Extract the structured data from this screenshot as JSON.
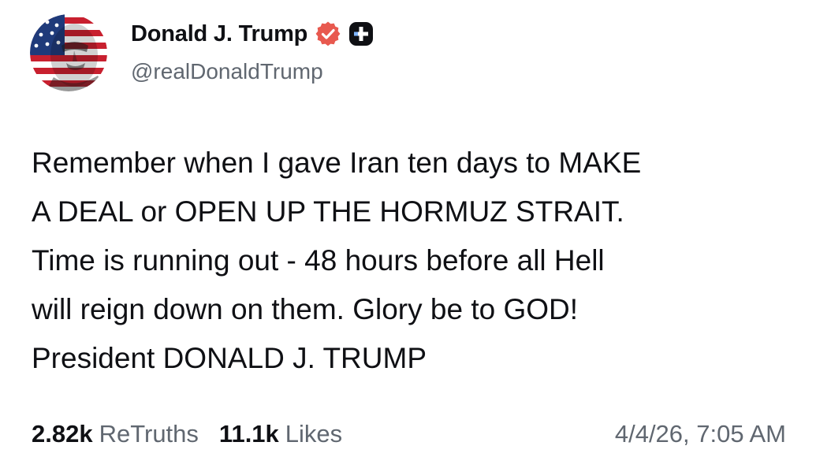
{
  "author": {
    "name": "Donald J. Trump",
    "handle": "@realDonaldTrump",
    "avatar_icon": "flag-portrait-avatar",
    "verified_icon": "verified-badge-icon",
    "badge_icon": "plus-badge-icon"
  },
  "post": {
    "lines": [
      "Remember when I gave Iran ten days to MAKE",
      "A DEAL or OPEN UP THE HORMUZ STRAIT.",
      "Time is running out - 48 hours before all Hell",
      "will reign down on them. Glory be to GOD!",
      "President DONALD J. TRUMP"
    ]
  },
  "stats": {
    "retruths_count": "2.82k",
    "retruths_label": "ReTruths",
    "likes_count": "11.1k",
    "likes_label": "Likes"
  },
  "timestamp": "4/4/26, 7:05 AM",
  "colors": {
    "text": "#0f1014",
    "muted": "#606770",
    "verified": "#e8594f",
    "background": "#ffffff"
  }
}
